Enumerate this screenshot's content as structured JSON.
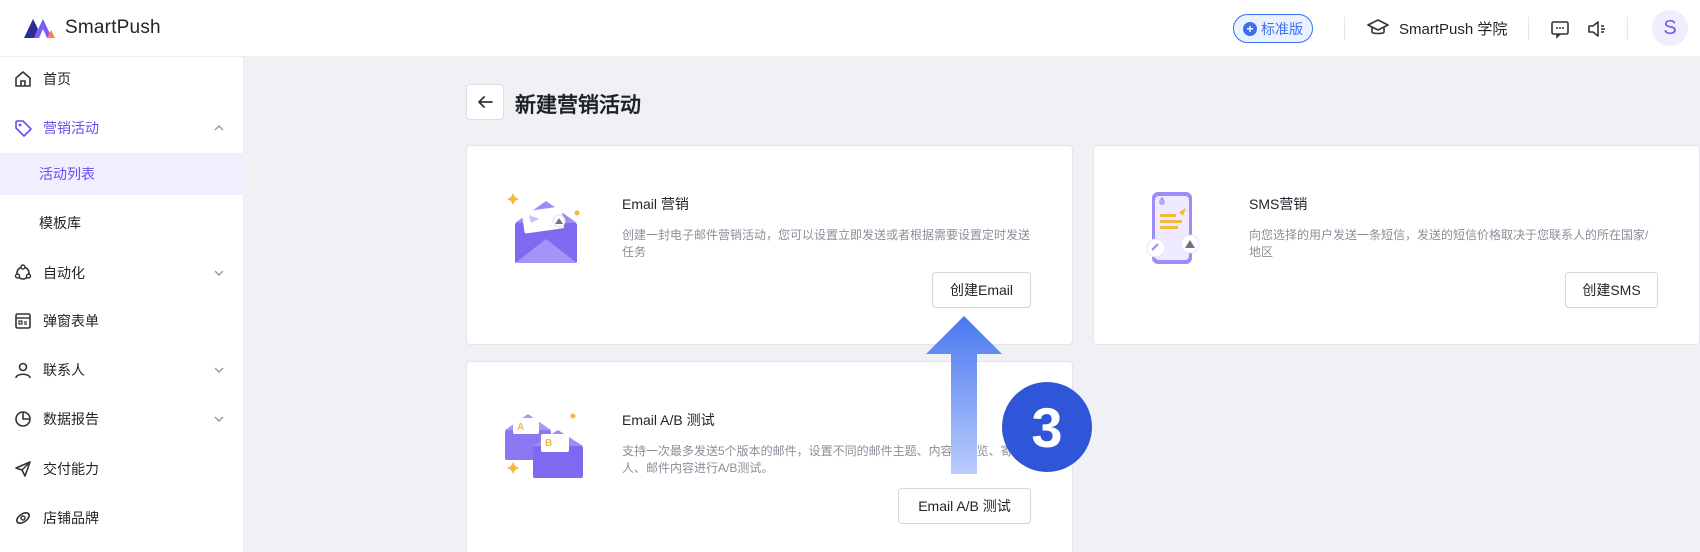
{
  "header": {
    "brand": "SmartPush",
    "plan_badge": "标准版",
    "academy_label": "SmartPush 学院",
    "avatar_initial": "S"
  },
  "sidebar": {
    "items": [
      {
        "label": "首页",
        "icon": "home-icon"
      },
      {
        "label": "营销活动",
        "icon": "tag-icon",
        "expanded": true
      },
      {
        "label": "活动列表",
        "selected": true
      },
      {
        "label": "模板库"
      },
      {
        "label": "自动化",
        "icon": "automation-icon"
      },
      {
        "label": "弹窗表单",
        "icon": "form-icon"
      },
      {
        "label": "联系人",
        "icon": "user-icon"
      },
      {
        "label": "数据报告",
        "icon": "pie-chart-icon"
      },
      {
        "label": "交付能力",
        "icon": "send-icon"
      },
      {
        "label": "店铺品牌",
        "icon": "brand-icon"
      }
    ]
  },
  "main": {
    "title": "新建营销活动",
    "cards": [
      {
        "title": "Email 营销",
        "description": "创建一封电子邮件营销活动，您可以设置立即发送或者根据需要设置定时发送任务",
        "button": "创建Email"
      },
      {
        "title": "SMS营销",
        "description": "向您选择的用户发送一条短信，发送的短信价格取决于您联系人的所在国家/地区",
        "button": "创建SMS"
      },
      {
        "title": "Email A/B 测试",
        "description": "支持一次最多发送5个版本的邮件，设置不同的邮件主题、内容、预览、寄件人、邮件内容进行A/B测试。",
        "button": "Email A/B 测试"
      }
    ]
  },
  "annotation": {
    "step": "3"
  },
  "colors": {
    "accent": "#6a4cf0",
    "badge_blue": "#3b6ff5",
    "step_badge": "#2f56d8"
  }
}
